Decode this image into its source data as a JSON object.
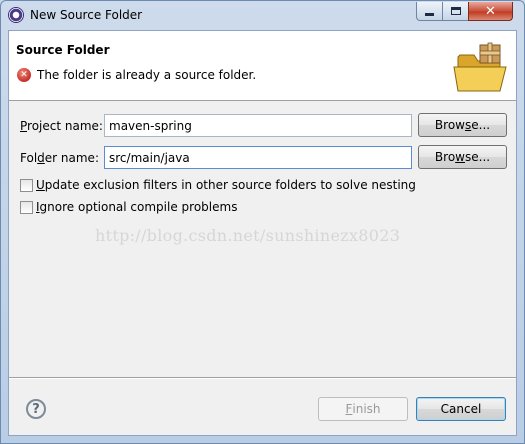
{
  "window": {
    "title": "New Source Folder"
  },
  "header": {
    "title": "Source Folder",
    "error_message": "The folder is already a source folder."
  },
  "form": {
    "project_label_pre": "",
    "project_label_mn": "P",
    "project_label_post": "roject name:",
    "project_value": "maven-spring",
    "folder_label_pre": "Fol",
    "folder_label_mn": "d",
    "folder_label_post": "er name:",
    "folder_value": "src/main/java",
    "browse_label_pre": "Brow",
    "browse_label_mn": "s",
    "browse_label_post": "e...",
    "browse2_label_pre": "Bro",
    "browse2_label_mn": "w",
    "browse2_label_post": "se...",
    "update_mn": "U",
    "update_rest": "pdate exclusion filters in other source folders to solve nesting",
    "update_checked": false,
    "ignore_mn": "I",
    "ignore_rest": "gnore optional compile problems",
    "ignore_checked": false
  },
  "watermark": "http://blog.csdn.net/sunshinezx8023",
  "footer": {
    "help_glyph": "?",
    "finish_mn": "F",
    "finish_rest": "inish",
    "cancel_label": "Cancel"
  },
  "icons": {
    "app": "eclipse-icon",
    "error": "error-icon",
    "folder": "open-folder-package-icon",
    "help": "help-icon"
  },
  "colors": {
    "error_red": "#c4302a",
    "disabled_text": "#9a9a9a",
    "watermark": "#d6d6d6"
  }
}
